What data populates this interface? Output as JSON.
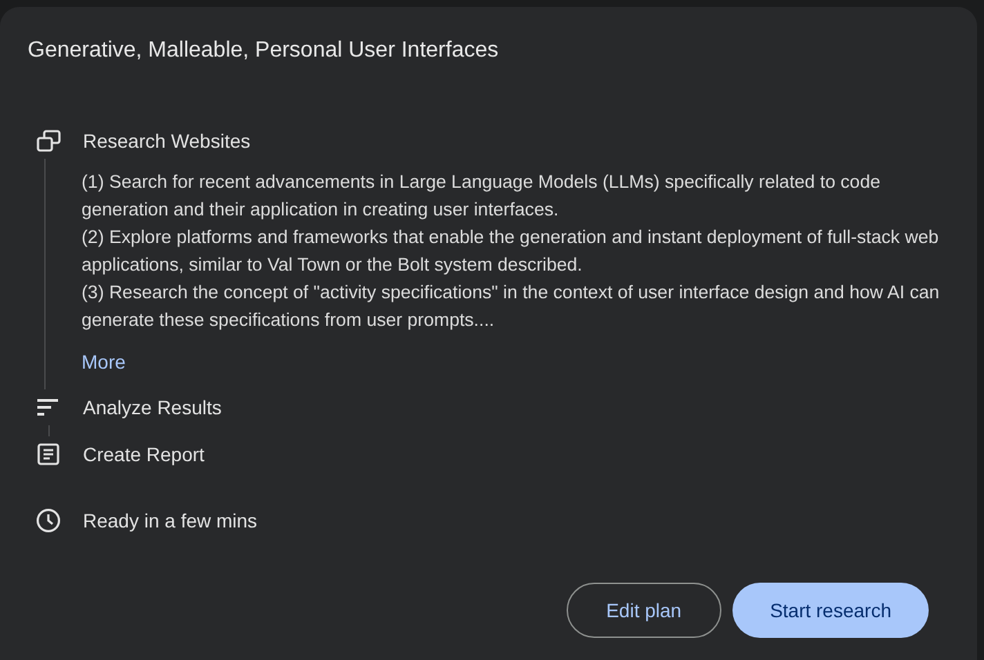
{
  "title": "Generative, Malleable, Personal User Interfaces",
  "steps": [
    {
      "kind": "websites",
      "label": "Research Websites",
      "details": [
        "(1) Search for recent advancements in Large Language Models (LLMs) specifically related to code generation and their application in creating user interfaces.",
        "(2) Explore platforms and frameworks that enable the generation and instant deployment of full-stack web applications, similar to Val Town or the Bolt system described.",
        "(3) Research the concept of \"activity specifications\" in the context of user interface design and how AI can generate these specifications from user prompts...."
      ],
      "more": "More"
    },
    {
      "kind": "analyze",
      "label": "Analyze Results"
    },
    {
      "kind": "report",
      "label": "Create Report"
    }
  ],
  "eta": "Ready in a few mins",
  "buttons": [
    {
      "kind": "outline",
      "label": "Edit plan"
    },
    {
      "kind": "filled",
      "label": "Start research"
    }
  ]
}
